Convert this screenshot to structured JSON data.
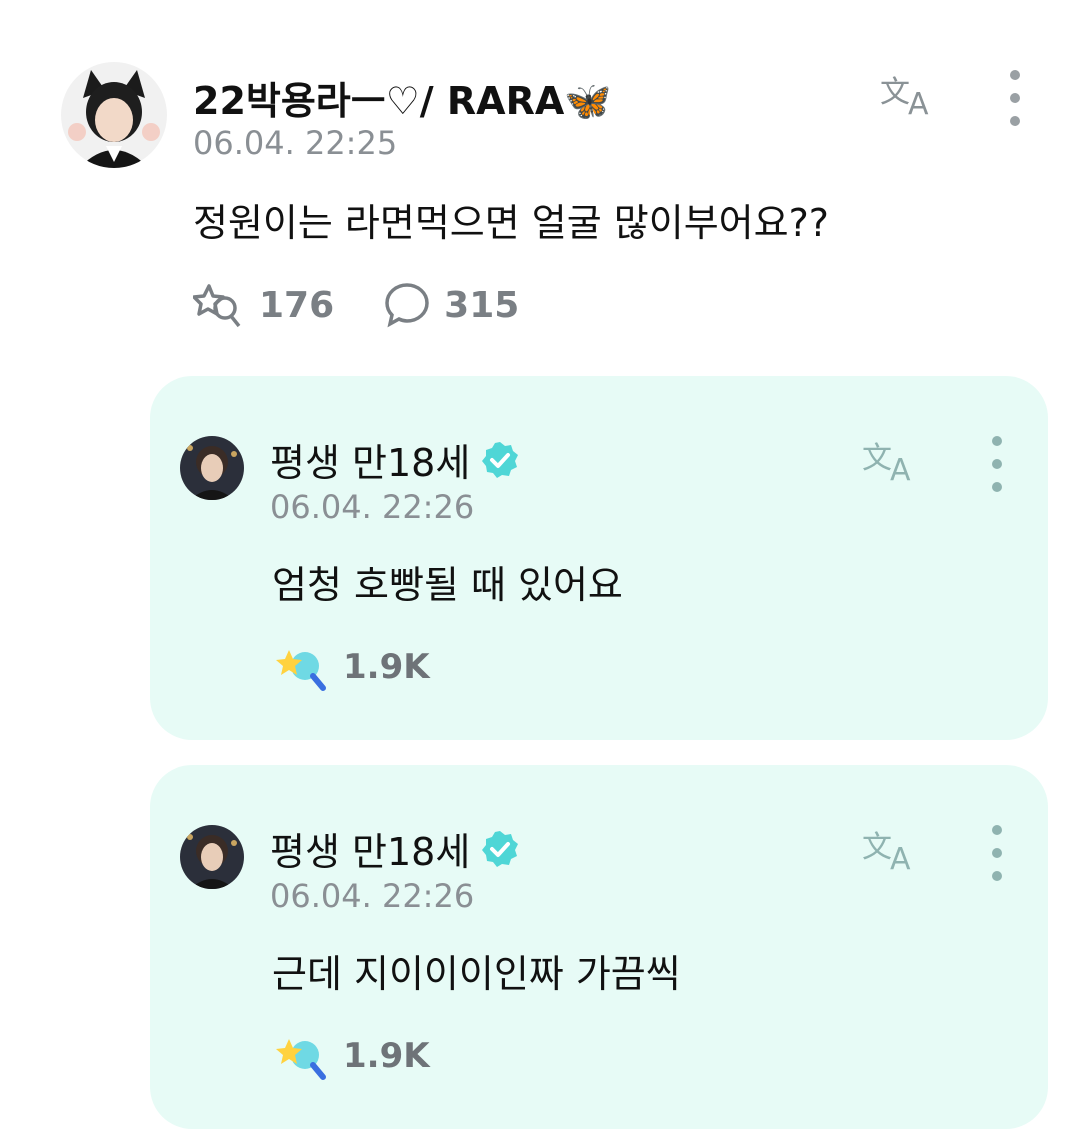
{
  "post": {
    "author": "22박용라ㅡ♡/ RARA🦋",
    "time": "06.04. 22:25",
    "text": "정원이는 라면먹으면 얼굴 많이부어요??",
    "likes": "176",
    "comments": "315",
    "translate_icon": "translate-icon",
    "more_icon": "more-vertical-icon"
  },
  "replies": [
    {
      "author": "평생 만18세",
      "verified": true,
      "time": "06.04. 22:26",
      "text": "엄청 호빵될 때 있어요",
      "likes": "1.9K"
    },
    {
      "author": "평생 만18세",
      "verified": true,
      "time": "06.04. 22:26",
      "text": "근데 지이이이인짜 가끔씩",
      "likes": "1.9K"
    }
  ],
  "colors": {
    "card_background": "#e7fbf6",
    "verified_badge": "#4fd6d6",
    "muted_text": "#8a8f94"
  }
}
